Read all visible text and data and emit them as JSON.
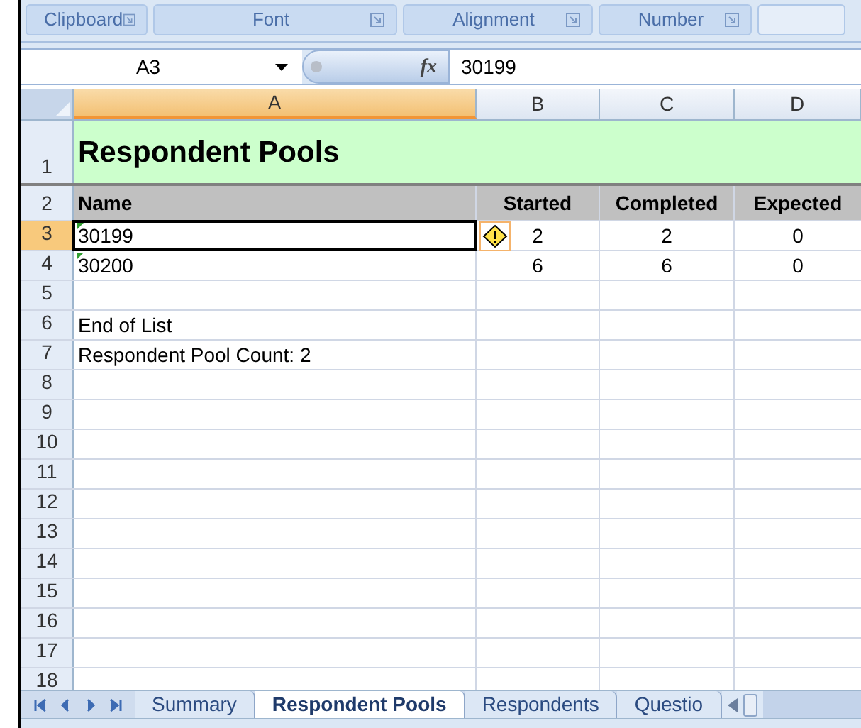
{
  "ribbon_groups": [
    "Clipboard",
    "Font",
    "Alignment",
    "Number"
  ],
  "formula_bar": {
    "name_box": "A3",
    "function_label": "fx",
    "formula": "30199"
  },
  "columns": [
    {
      "label": "A",
      "selected": true
    },
    {
      "label": "B",
      "selected": false
    },
    {
      "label": "C",
      "selected": false
    },
    {
      "label": "D",
      "selected": false
    }
  ],
  "rows": [
    {
      "number": "1",
      "kind": "title",
      "selected": false,
      "flagged": false,
      "warning": false,
      "name": "Respondent Pools"
    },
    {
      "number": "2",
      "kind": "header",
      "selected": false,
      "flagged": false,
      "warning": false,
      "name": "Name",
      "started": "Started",
      "completed": "Completed",
      "expected": "Expected"
    },
    {
      "number": "3",
      "kind": "data",
      "selected": true,
      "flagged": true,
      "warning": true,
      "name": "30199",
      "started": "2",
      "completed": "2",
      "expected": "0"
    },
    {
      "number": "4",
      "kind": "data",
      "selected": false,
      "flagged": true,
      "warning": false,
      "name": "30200",
      "started": "6",
      "completed": "6",
      "expected": "0"
    },
    {
      "number": "5",
      "kind": "data",
      "selected": false,
      "flagged": false,
      "warning": false
    },
    {
      "number": "6",
      "kind": "data",
      "selected": false,
      "flagged": false,
      "warning": false,
      "name": "End of List"
    },
    {
      "number": "7",
      "kind": "data",
      "selected": false,
      "flagged": false,
      "warning": false,
      "name": "Respondent Pool Count: 2"
    },
    {
      "number": "8",
      "kind": "data",
      "selected": false,
      "flagged": false,
      "warning": false
    },
    {
      "number": "9",
      "kind": "data",
      "selected": false,
      "flagged": false,
      "warning": false
    },
    {
      "number": "10",
      "kind": "data",
      "selected": false,
      "flagged": false,
      "warning": false
    },
    {
      "number": "11",
      "kind": "data",
      "selected": false,
      "flagged": false,
      "warning": false
    },
    {
      "number": "12",
      "kind": "data",
      "selected": false,
      "flagged": false,
      "warning": false
    },
    {
      "number": "13",
      "kind": "data",
      "selected": false,
      "flagged": false,
      "warning": false
    },
    {
      "number": "14",
      "kind": "data",
      "selected": false,
      "flagged": false,
      "warning": false
    },
    {
      "number": "15",
      "kind": "data",
      "selected": false,
      "flagged": false,
      "warning": false
    },
    {
      "number": "16",
      "kind": "data",
      "selected": false,
      "flagged": false,
      "warning": false
    },
    {
      "number": "17",
      "kind": "data",
      "selected": false,
      "flagged": false,
      "warning": false
    },
    {
      "number": "18",
      "kind": "data",
      "selected": false,
      "flagged": false,
      "warning": false
    }
  ],
  "sheet_tabs": [
    {
      "label": "Summary",
      "selected": false
    },
    {
      "label": "Respondent Pools",
      "selected": true
    },
    {
      "label": "Respondents",
      "selected": false
    },
    {
      "label": "Questio",
      "selected": false
    }
  ]
}
